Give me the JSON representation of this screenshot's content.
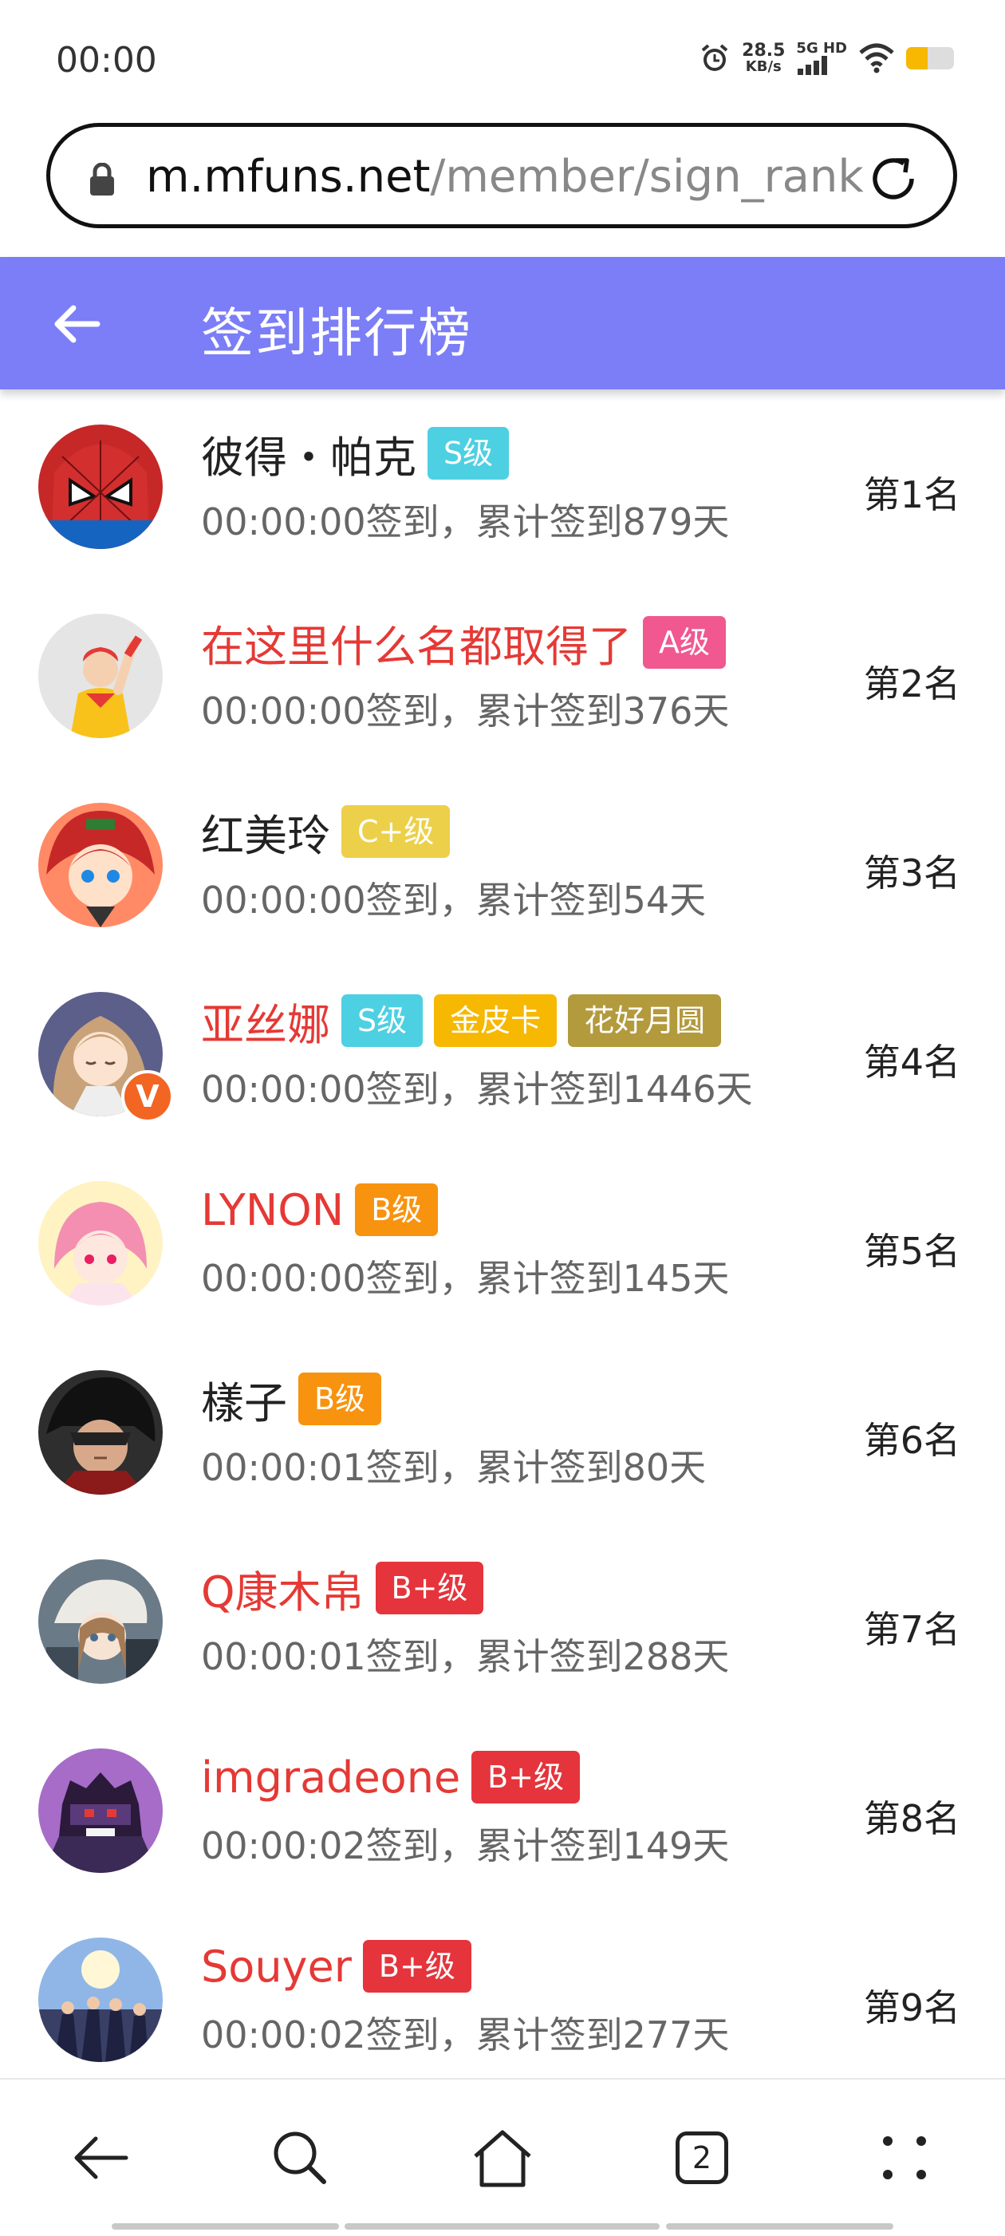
{
  "status": {
    "time": "00:00",
    "speed_value": "28.5",
    "speed_unit": "KB/s",
    "network": "5G HD",
    "icons": [
      "alarm-icon",
      "signal-icon",
      "wifi-icon",
      "battery-icon"
    ],
    "battery_level": 0.45
  },
  "browser": {
    "host": "m.mfuns.net",
    "path": "/member/sign_rank",
    "tab_count": "2"
  },
  "header": {
    "title": "签到排行榜"
  },
  "colors": {
    "header": "#7b7ef6",
    "red_name": "#e53935",
    "S": "#4dd0e1",
    "A": "#f0588f",
    "Cplus": "#ecd04a",
    "B": "#f7930e",
    "Bplus": "#e5343c",
    "gold": "#f6b800",
    "olive": "#b39a3c"
  },
  "ranks": [
    {
      "name": "彼得・帕克",
      "name_style": "normal",
      "badges": [
        {
          "text": "S级",
          "color": "#4dd0e1"
        }
      ],
      "sign": "00:00:00签到，累计签到879天",
      "rank": "第1名"
    },
    {
      "name": "在这里什么名都取得了",
      "name_style": "red",
      "badges": [
        {
          "text": "A级",
          "color": "#f0588f"
        }
      ],
      "sign": "00:00:00签到，累计签到376天",
      "rank": "第2名"
    },
    {
      "name": "红美玲",
      "name_style": "normal",
      "badges": [
        {
          "text": "C+级",
          "color": "#ecd04a"
        }
      ],
      "sign": "00:00:00签到，累计签到54天",
      "rank": "第3名"
    },
    {
      "name": "亚丝娜",
      "name_style": "red",
      "verified": "V",
      "badges": [
        {
          "text": "S级",
          "color": "#4dd0e1"
        },
        {
          "text": "金皮卡",
          "color": "#f6b800"
        },
        {
          "text": "花好月圆",
          "color": "#b39a3c"
        }
      ],
      "sign": "00:00:00签到，累计签到1446天",
      "rank": "第4名"
    },
    {
      "name": "LYNON",
      "name_style": "red",
      "badges": [
        {
          "text": "B级",
          "color": "#f7930e"
        }
      ],
      "sign": "00:00:00签到，累计签到145天",
      "rank": "第5名"
    },
    {
      "name": "樣子",
      "name_style": "normal",
      "badges": [
        {
          "text": "B级",
          "color": "#f7930e"
        }
      ],
      "sign": "00:00:01签到，累计签到80天",
      "rank": "第6名"
    },
    {
      "name": "Q康木帛",
      "name_style": "red",
      "badges": [
        {
          "text": "B+级",
          "color": "#e5343c"
        }
      ],
      "sign": "00:00:01签到，累计签到288天",
      "rank": "第7名"
    },
    {
      "name": "imgradeone",
      "name_style": "red",
      "badges": [
        {
          "text": "B+级",
          "color": "#e5343c"
        }
      ],
      "sign": "00:00:02签到，累计签到149天",
      "rank": "第8名"
    },
    {
      "name": "Souyer",
      "name_style": "red",
      "badges": [
        {
          "text": "B+级",
          "color": "#e5343c"
        }
      ],
      "sign": "00:00:02签到，累计签到277天",
      "rank": "第9名"
    }
  ]
}
